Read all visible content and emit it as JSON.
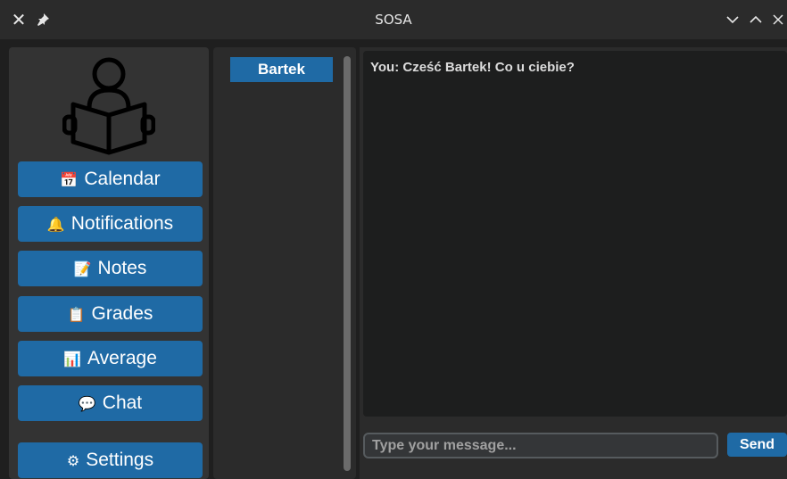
{
  "window": {
    "title": "SOSA",
    "close_glyph": "✕",
    "pin_glyph": "📌",
    "minimize_glyph": "∨",
    "maximize_glyph": "∧",
    "close_right_glyph": "✕"
  },
  "sidebar": {
    "logo_icon": "person-reading-book-icon",
    "items": [
      {
        "label": "Calendar",
        "icon": "📅"
      },
      {
        "label": "Notifications",
        "icon": "🔔"
      },
      {
        "label": "Notes",
        "icon": "📝"
      },
      {
        "label": "Grades",
        "icon": "📋"
      },
      {
        "label": "Average",
        "icon": "📊"
      },
      {
        "label": "Chat",
        "icon": "💬"
      }
    ],
    "settings": {
      "label": "Settings",
      "icon": "⚙"
    }
  },
  "contacts": {
    "items": [
      {
        "label": "Bartek"
      }
    ]
  },
  "chat": {
    "messages": [
      {
        "text": "You: Cześć Bartek! Co u ciebie?"
      }
    ],
    "input": {
      "value": "",
      "placeholder": "Type your message..."
    },
    "send_label": "Send"
  },
  "colors": {
    "accent": "#1f6aa5",
    "sidebar_bg": "#333333",
    "panel_bg": "#2b2b2b",
    "chat_bg": "#1d1e1e"
  }
}
